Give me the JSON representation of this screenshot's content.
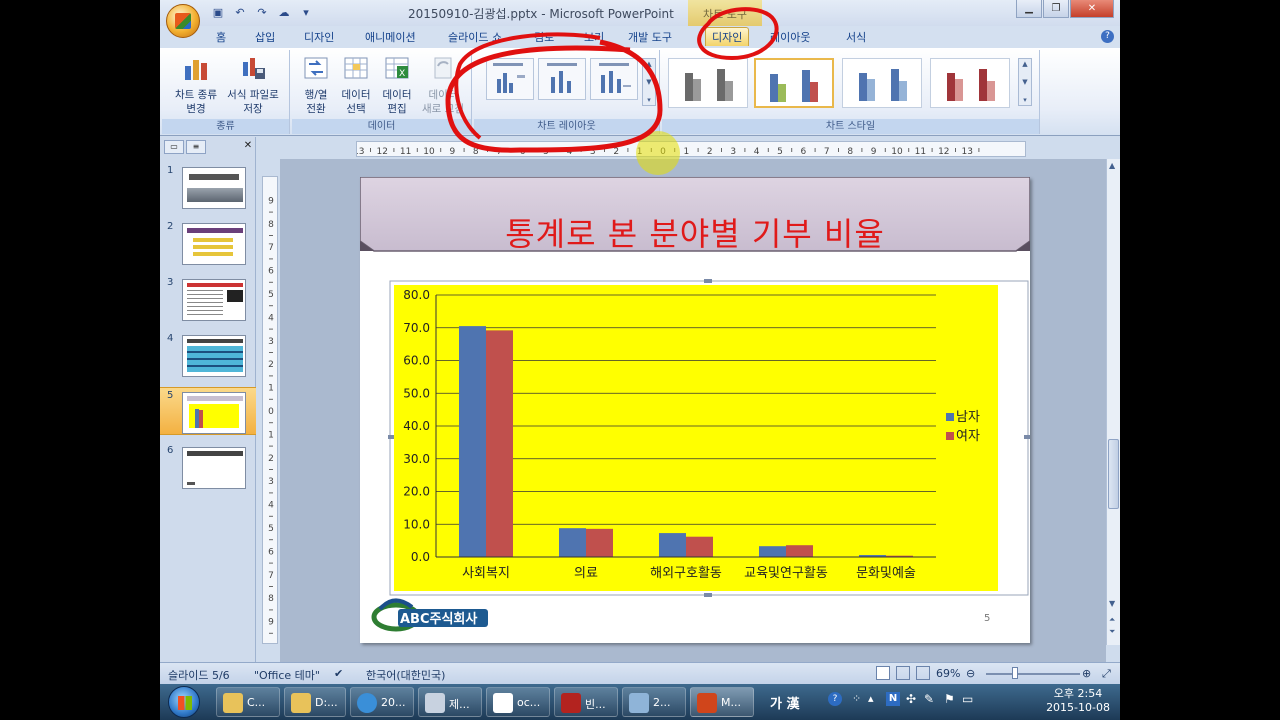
{
  "window": {
    "title": "20150910-김광섭.pptx - Microsoft PowerPoint",
    "contextual_tab_group": "차트 도구"
  },
  "tabs": [
    "홈",
    "삽입",
    "디자인",
    "애니메이션",
    "슬라이드 쇼",
    "검토",
    "보기",
    "개발 도구",
    "디자인",
    "레이아웃",
    "서식"
  ],
  "ribbon": {
    "groups": {
      "type": {
        "label": "종류",
        "buttons": [
          {
            "line1": "차트 종류",
            "line2": "변경"
          },
          {
            "line1": "서식 파일로",
            "line2": "저장"
          }
        ]
      },
      "data": {
        "label": "데이터",
        "buttons": [
          {
            "line1": "행/열",
            "line2": "전환"
          },
          {
            "line1": "데이터",
            "line2": "선택"
          },
          {
            "line1": "데이터",
            "line2": "편집"
          },
          {
            "line1": "데이터",
            "line2": "새로 고침"
          }
        ]
      },
      "layouts": {
        "label": "차트 레이아웃"
      },
      "styles": {
        "label": "차트 스타일"
      }
    }
  },
  "slides_pane": {
    "count": 6,
    "selected": 5,
    "numbers": [
      "1",
      "2",
      "3",
      "4",
      "5",
      "6"
    ]
  },
  "slide": {
    "title": "통계로 본 분야별 기부 비율",
    "page_number": "5",
    "logo_text": "ABC주식회사"
  },
  "chart_data": {
    "type": "bar",
    "categories": [
      "사회복지",
      "의료",
      "해외구호활동",
      "교육및연구활동",
      "문화및예술"
    ],
    "series": [
      {
        "name": "남자",
        "values": [
          70.5,
          8.8,
          7.3,
          3.3,
          0.6
        ],
        "color": "#4f74b0"
      },
      {
        "name": "여자",
        "values": [
          69.2,
          8.6,
          6.2,
          3.6,
          0.4
        ],
        "color": "#c0504d"
      }
    ],
    "yticks": [
      "0.0",
      "10.0",
      "20.0",
      "30.0",
      "40.0",
      "50.0",
      "60.0",
      "70.0",
      "80.0"
    ],
    "ylim": [
      0,
      80
    ],
    "grid": true,
    "legend": "right",
    "plot_background": "#ffff00"
  },
  "status": {
    "slide": "슬라이드 5/6",
    "theme": "\"Office 테마\"",
    "language": "한국어(대한민국)",
    "zoom": "69%"
  },
  "taskbar": {
    "items": [
      "C...",
      "D:...",
      "20...",
      "제...",
      "oc...",
      "빈...",
      "2...",
      "M..."
    ],
    "tray_ime": "가 漢",
    "clock_time": "오후 2:54",
    "clock_date": "2015-10-08"
  }
}
